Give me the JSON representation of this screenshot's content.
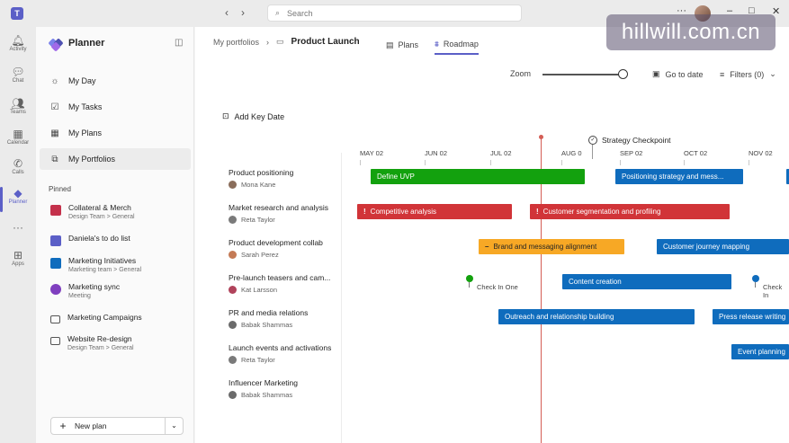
{
  "titlebar": {
    "back": "‹",
    "forward": "›",
    "search_placeholder": "Search",
    "more": "···",
    "minimize": "–",
    "maximize": "□",
    "close": "✕"
  },
  "watermark": "hillwill.com.cn",
  "rail": [
    {
      "label": "Activity",
      "icon": "bell-icon",
      "glyph": "🔔︎"
    },
    {
      "label": "Chat",
      "icon": "chat-icon",
      "glyph": "💬︎"
    },
    {
      "label": "Teams",
      "icon": "teams-icon",
      "glyph": "👥︎"
    },
    {
      "label": "Calendar",
      "icon": "calendar-icon",
      "glyph": "▦"
    },
    {
      "label": "Calls",
      "icon": "phone-icon",
      "glyph": "✆"
    },
    {
      "label": "Planner",
      "icon": "planner-icon",
      "glyph": "◆"
    },
    {
      "label": "",
      "icon": "more-icon",
      "glyph": "···"
    },
    {
      "label": "Apps",
      "icon": "apps-icon",
      "glyph": "⊞"
    }
  ],
  "sidebar": {
    "title": "Planner",
    "nav": [
      {
        "label": "My Day",
        "glyph": "☼"
      },
      {
        "label": "My Tasks",
        "glyph": "☑"
      },
      {
        "label": "My Plans",
        "glyph": "▦"
      },
      {
        "label": "My Portfolios",
        "glyph": "⧉"
      }
    ],
    "pinned_label": "Pinned",
    "pinned": [
      {
        "title": "Collateral & Merch",
        "sub": "Design Team > General",
        "color": "#c4314b"
      },
      {
        "title": "Daniela's to do list",
        "sub": "",
        "color": "#5b5fc7"
      },
      {
        "title": "Marketing Initiatives",
        "sub": "Marketing team > General",
        "color": "#0f6cbd"
      },
      {
        "title": "Marketing sync",
        "sub": "Meeting",
        "color": "#7f3fbf"
      },
      {
        "title": "Marketing Campaigns",
        "sub": "",
        "color": ""
      },
      {
        "title": "Website Re-design",
        "sub": "Design Team > General",
        "color": ""
      }
    ],
    "new_plan": "New plan",
    "new_plan_plus": "+",
    "new_plan_chevron": "⌄"
  },
  "main": {
    "crumbs": {
      "parent": "My portfolios",
      "sep": "›",
      "current": "Product Launch"
    },
    "tabs": [
      {
        "label": "Plans",
        "glyph": "▤",
        "active": false
      },
      {
        "label": "Roadmap",
        "glyph": "⩩",
        "active": true
      }
    ],
    "zoom_label": "Zoom",
    "goto_label": "Go to date",
    "filters_label": "Filters (0)",
    "filters_chevron": "⌄",
    "add_key_date": "Add Key Date",
    "checkpoint": "Strategy Checkpoint",
    "months": [
      "MAY 02",
      "JUN 02",
      "JUL 02",
      "AUG 0",
      "SEP 02",
      "OCT 02",
      "NOV 02"
    ],
    "rows": [
      {
        "title": "Product positioning",
        "owner": "Mona Kane",
        "av": "#8a6d5b"
      },
      {
        "title": "Market research and analysis",
        "owner": "Reta Taylor",
        "av": "#7a7a7a"
      },
      {
        "title": "Product development collab",
        "owner": "Sarah Perez",
        "av": "#c47a55"
      },
      {
        "title": "Pre-launch teasers and cam...",
        "owner": "Kat Larsson",
        "av": "#b0435b"
      },
      {
        "title": "PR and media relations",
        "owner": "Babak Shammas",
        "av": "#6b6b6b"
      },
      {
        "title": "Launch events and activations",
        "owner": "Reta Taylor",
        "av": "#7a7a7a"
      },
      {
        "title": "Influencer Marketing",
        "owner": "Babak Shammas",
        "av": "#6b6b6b"
      }
    ],
    "bars": [
      {
        "label": "Define UVP",
        "warn": "",
        "color": "green"
      },
      {
        "label": "Positioning strategy and mess...",
        "warn": "",
        "color": "blue"
      },
      {
        "label": "",
        "warn": "",
        "color": "blue"
      },
      {
        "label": "Competitive analysis",
        "warn": "!",
        "color": "red"
      },
      {
        "label": "Customer segmentation and profiling",
        "warn": "!",
        "color": "red"
      },
      {
        "label": "Brand and messaging alignment",
        "warn": "–",
        "color": "orange"
      },
      {
        "label": "Customer journey mapping",
        "warn": "",
        "color": "blue"
      },
      {
        "label": "Content creation",
        "warn": "",
        "color": "blue"
      },
      {
        "label": "Outreach and relationship building",
        "warn": "",
        "color": "blue"
      },
      {
        "label": "Press release writing",
        "warn": "",
        "color": "blue"
      },
      {
        "label": "Event planning",
        "warn": "",
        "color": "blue"
      }
    ],
    "milestones": [
      {
        "label": "Check In One",
        "color": "#13a10e"
      },
      {
        "label": "Check In",
        "color": "#0f6cbd"
      }
    ]
  }
}
